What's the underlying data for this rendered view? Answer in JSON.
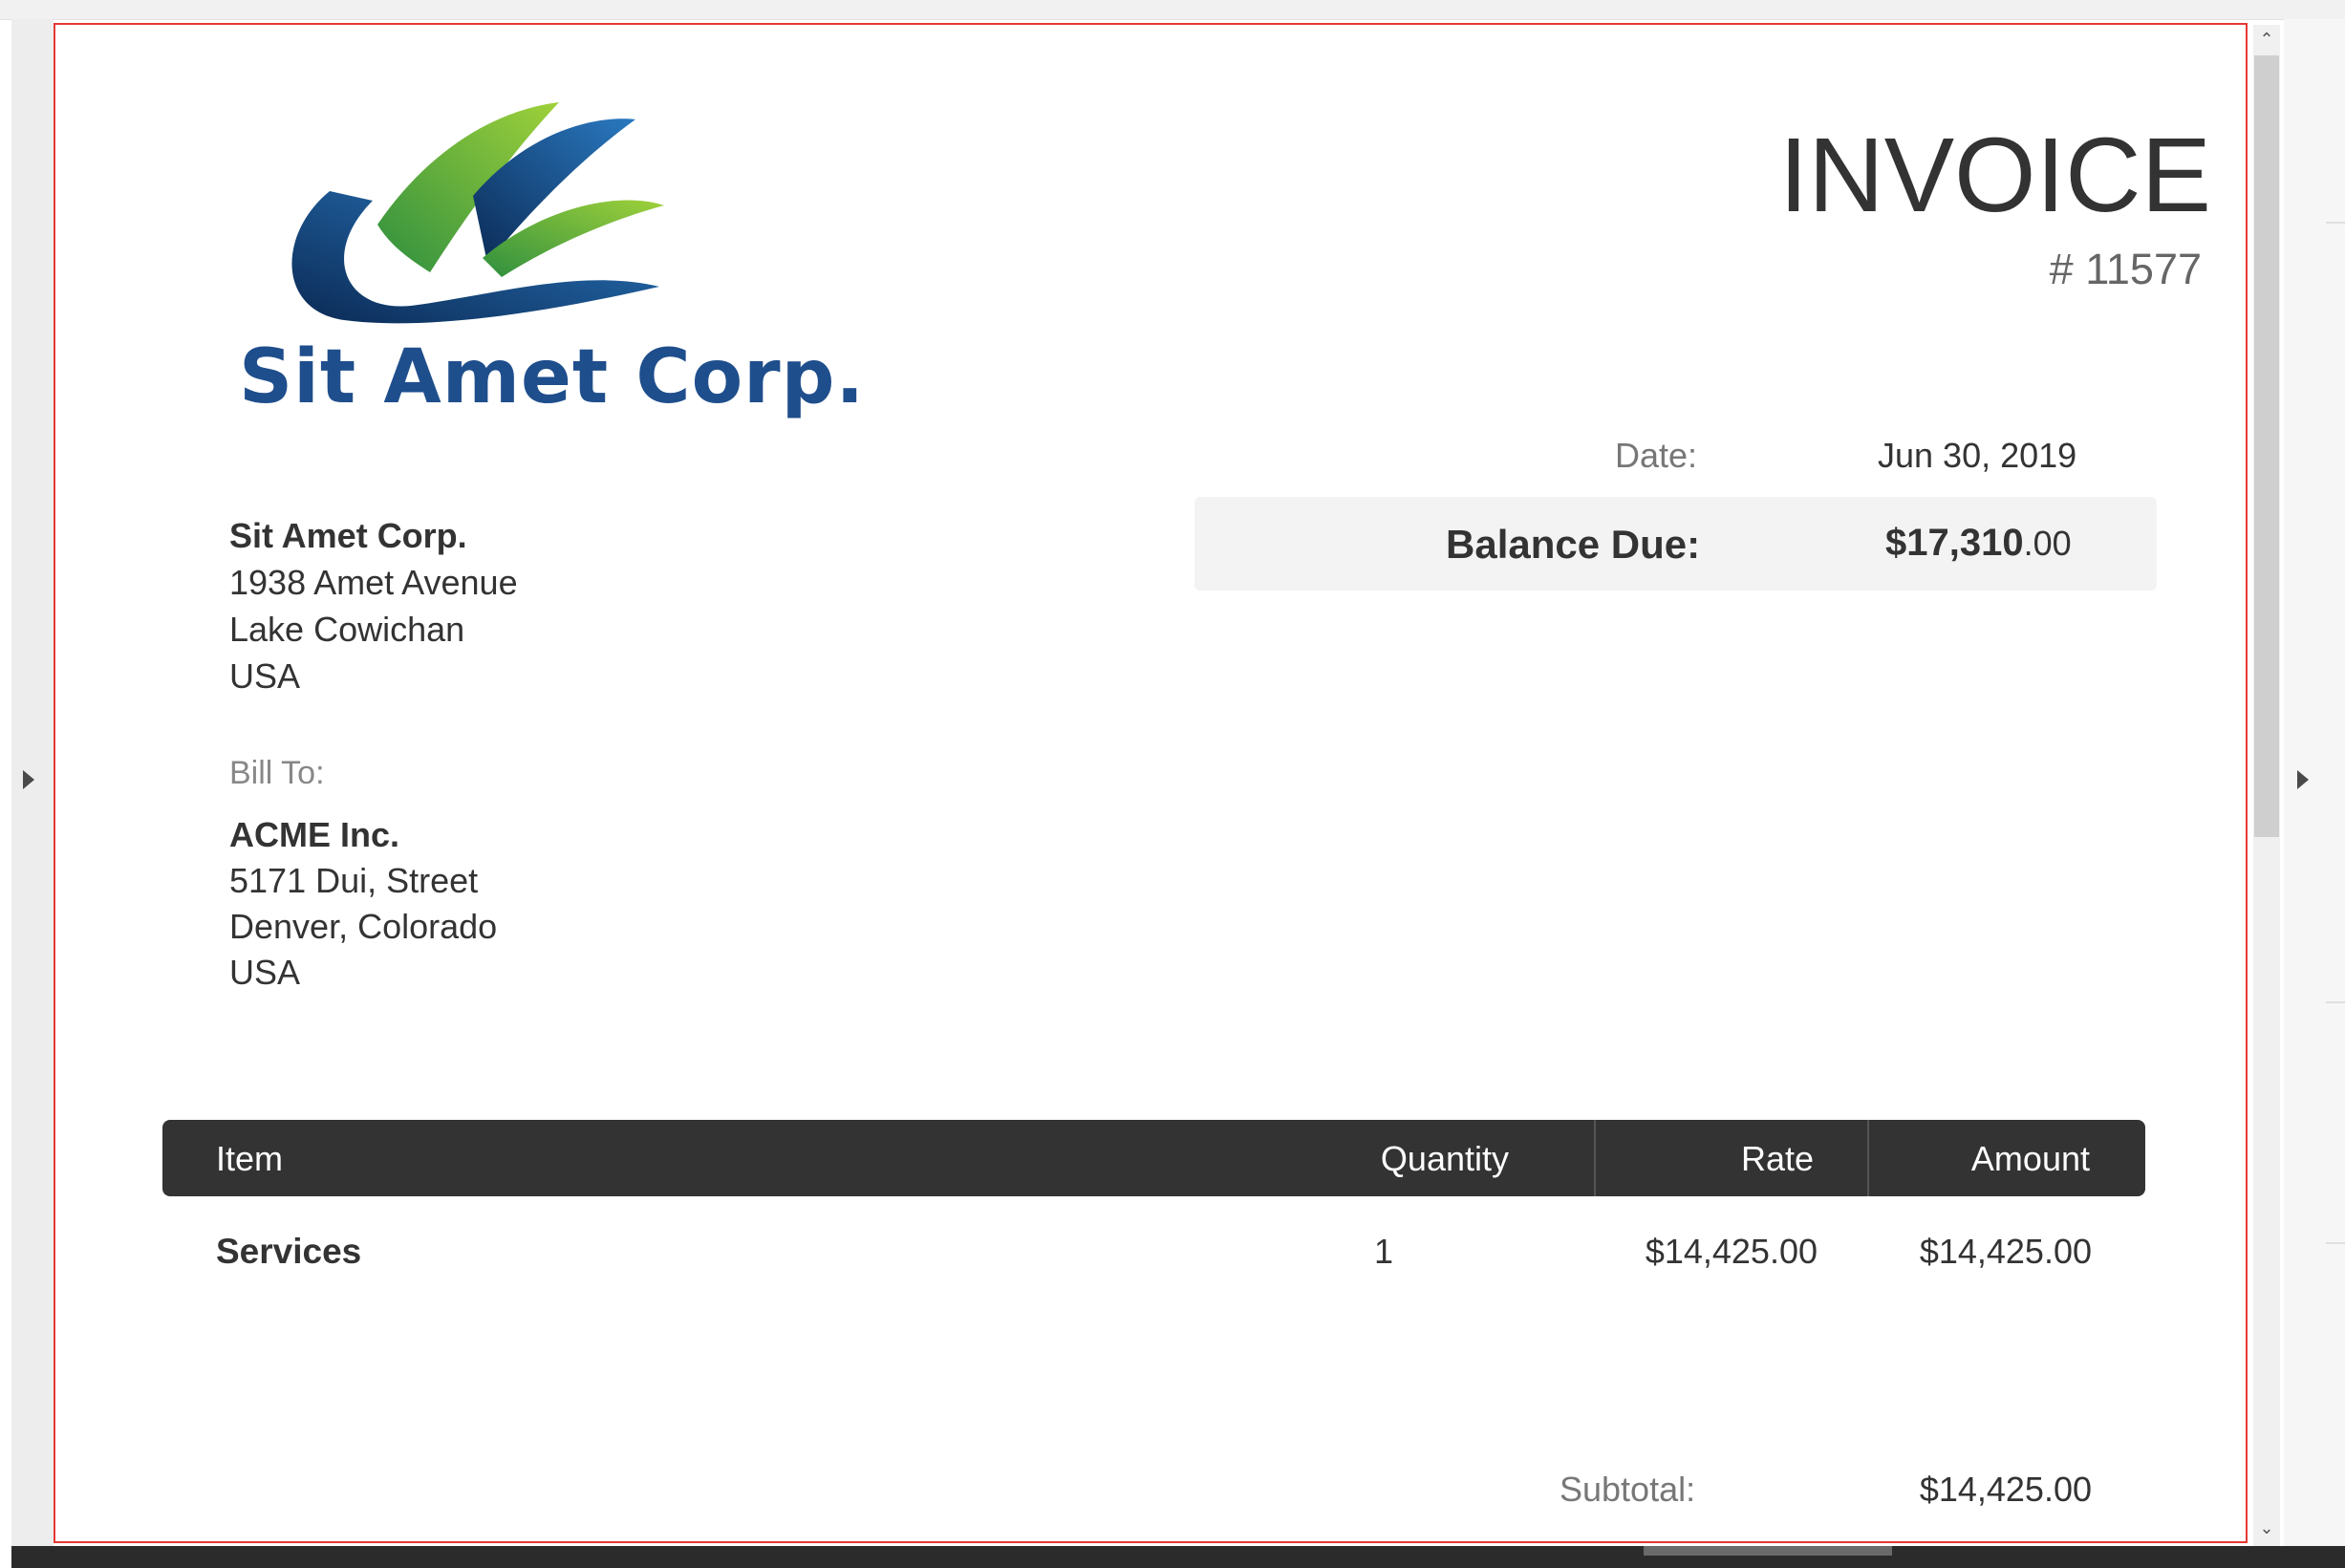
{
  "invoice": {
    "title": "INVOICE",
    "number": "# 11577",
    "date_label": "Date:",
    "date_value": "Jun 30, 2019",
    "balance_label": "Balance Due:",
    "balance_main": "$17,310",
    "balance_cents": ".00"
  },
  "company": {
    "logo_text": "Sit Amet Corp.",
    "name": "Sit Amet Corp.",
    "address1": "1938 Amet Avenue",
    "city": "Lake Cowichan",
    "country": "USA"
  },
  "bill_to": {
    "label": "Bill To:",
    "name": "ACME Inc.",
    "address1": "5171 Dui, Street",
    "city": "Denver, Colorado",
    "country": "USA"
  },
  "table": {
    "headers": {
      "item": "Item",
      "quantity": "Quantity",
      "rate": "Rate",
      "amount": "Amount"
    },
    "rows": [
      {
        "item": "Services",
        "quantity": "1",
        "rate": "$14,425.00",
        "amount": "$14,425.00"
      }
    ]
  },
  "totals": {
    "subtotal_label": "Subtotal:",
    "subtotal_value": "$14,425.00"
  },
  "viewer": {
    "scroll_up_icon": "chevron-up-icon",
    "scroll_down_icon": "chevron-down-icon",
    "prev_icon": "triangle-right-icon",
    "next_icon": "triangle-right-icon"
  },
  "colors": {
    "logo_text": "#1f4e8c",
    "table_header": "#333333",
    "page_border": "#e53935"
  }
}
